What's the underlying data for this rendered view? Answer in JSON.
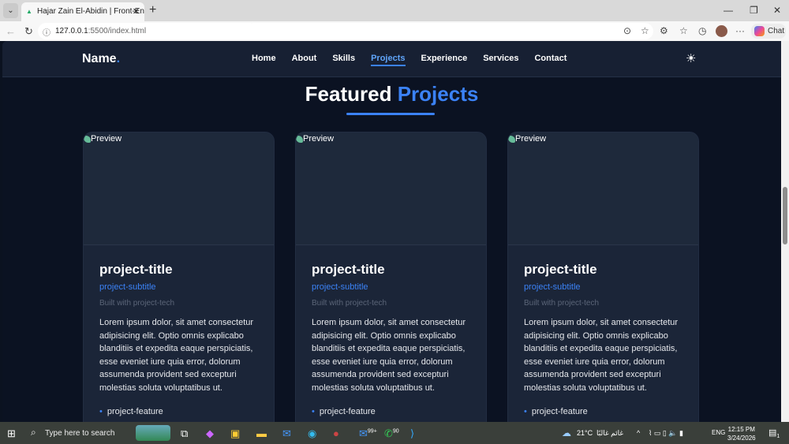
{
  "browser": {
    "tab_title": "Hajar Zain El-Abidin | Front-End Developer",
    "url_host": "127.0.0.1",
    "url_rest": ":5500/index.html",
    "chat_label": "Chat"
  },
  "navbar": {
    "logo": "Name",
    "logo_dot": ".",
    "links": [
      {
        "label": "Home"
      },
      {
        "label": "About"
      },
      {
        "label": "Skills"
      },
      {
        "label": "Projects"
      },
      {
        "label": "Experience"
      },
      {
        "label": "Services"
      },
      {
        "label": "Contact"
      }
    ],
    "active": "Projects"
  },
  "section": {
    "title_main": "Featured",
    "title_accent": "Projects"
  },
  "projects": [
    {
      "image_alt": "Preview",
      "title": "project-title",
      "subtitle": "project-subtitle",
      "tech": "Built with project-tech",
      "description": "Lorem ipsum dolor, sit amet consectetur adipisicing elit. Optio omnis explicabo blanditiis et expedita eaque perspiciatis, esse eveniet iure quia error, dolorum assumenda provident sed excepturi molestias soluta voluptatibus ut.",
      "feature": "project-feature"
    },
    {
      "image_alt": "Preview",
      "title": "project-title",
      "subtitle": "project-subtitle",
      "tech": "Built with project-tech",
      "description": "Lorem ipsum dolor, sit amet consectetur adipisicing elit. Optio omnis explicabo blanditiis et expedita eaque perspiciatis, esse eveniet iure quia error, dolorum assumenda provident sed excepturi molestias soluta voluptatibus ut.",
      "feature": "project-feature"
    },
    {
      "image_alt": "Preview",
      "title": "project-title",
      "subtitle": "project-subtitle",
      "tech": "Built with project-tech",
      "description": "Lorem ipsum dolor, sit amet consectetur adipisicing elit. Optio omnis explicabo blanditiis et expedita eaque perspiciatis, esse eveniet iure quia error, dolorum assumenda provident sed excepturi molestias soluta voluptatibus ut.",
      "feature": "project-feature"
    }
  ],
  "taskbar": {
    "search_placeholder": "Type here to search",
    "weather": "21°C",
    "weather_desc": "غائم غالبًا",
    "lang": "ENG",
    "time": "12:15 PM",
    "date": "3/24/2026",
    "mail_badge": "99+",
    "whatsapp_badge": "90",
    "notifications": "1"
  }
}
